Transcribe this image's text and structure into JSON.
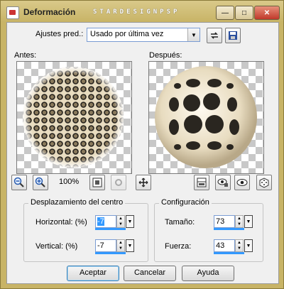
{
  "window": {
    "title": "Deformación",
    "brand": "STARDESIGNPSP"
  },
  "presets": {
    "label": "Ajustes pred.:",
    "value": "Usado por última vez"
  },
  "before_label": "Antes:",
  "after_label": "Después:",
  "zoom_level": "100%",
  "center_group": {
    "title": "Desplazamiento del centro",
    "horizontal_label": "Horizontal: (%)",
    "horizontal_value": "-7",
    "vertical_label": "Vertical: (%)",
    "vertical_value": "-7"
  },
  "config_group": {
    "title": "Configuración",
    "size_label": "Tamaño:",
    "size_value": "73",
    "strength_label": "Fuerza:",
    "strength_value": "43"
  },
  "buttons": {
    "ok": "Aceptar",
    "cancel": "Cancelar",
    "help": "Ayuda"
  },
  "window_controls": {
    "minimize": "—",
    "maximize": "□",
    "close": "✕"
  }
}
